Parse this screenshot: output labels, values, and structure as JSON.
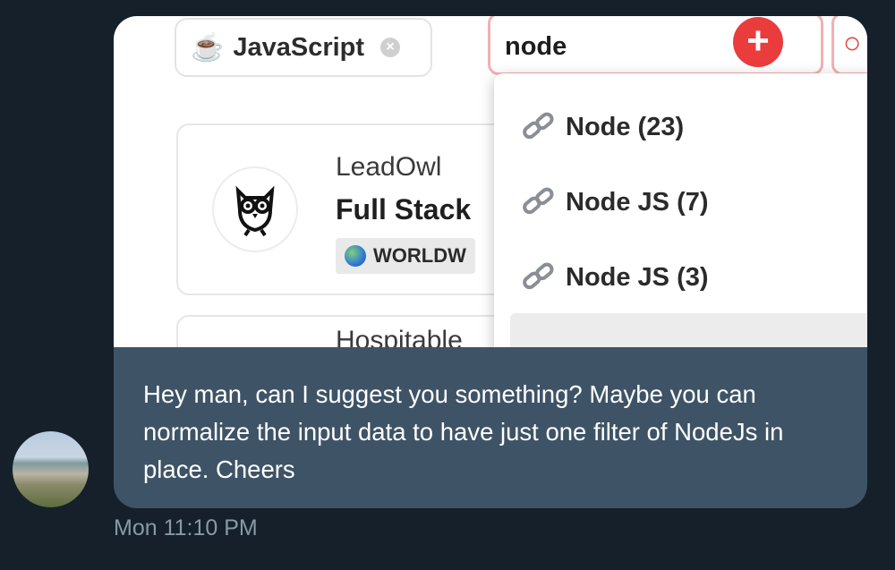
{
  "screenshot": {
    "tag_chip": {
      "icon": "coffee-icon",
      "label": "JavaScript"
    },
    "search": {
      "value": "node"
    },
    "jobs": [
      {
        "company": "LeadOwl",
        "role": "Full Stack",
        "location": "WORLDW"
      },
      {
        "company": "Hospitable"
      }
    ],
    "dropdown": {
      "options": [
        {
          "icon": "link-icon",
          "label": "Node (23)"
        },
        {
          "icon": "link-icon",
          "label": "Node JS (7)"
        },
        {
          "icon": "link-icon",
          "label": "Node JS (3)"
        }
      ]
    }
  },
  "message": {
    "text": "Hey man, can I suggest you something? Maybe you can normalize the input data to have just one filter of NodeJs in place. Cheers",
    "timestamp": "Mon 11:10 PM"
  },
  "colors": {
    "background": "#15202b",
    "bubble": "#3e5366",
    "accent_red": "#ea3c3c",
    "timestamp": "#8899a6"
  }
}
